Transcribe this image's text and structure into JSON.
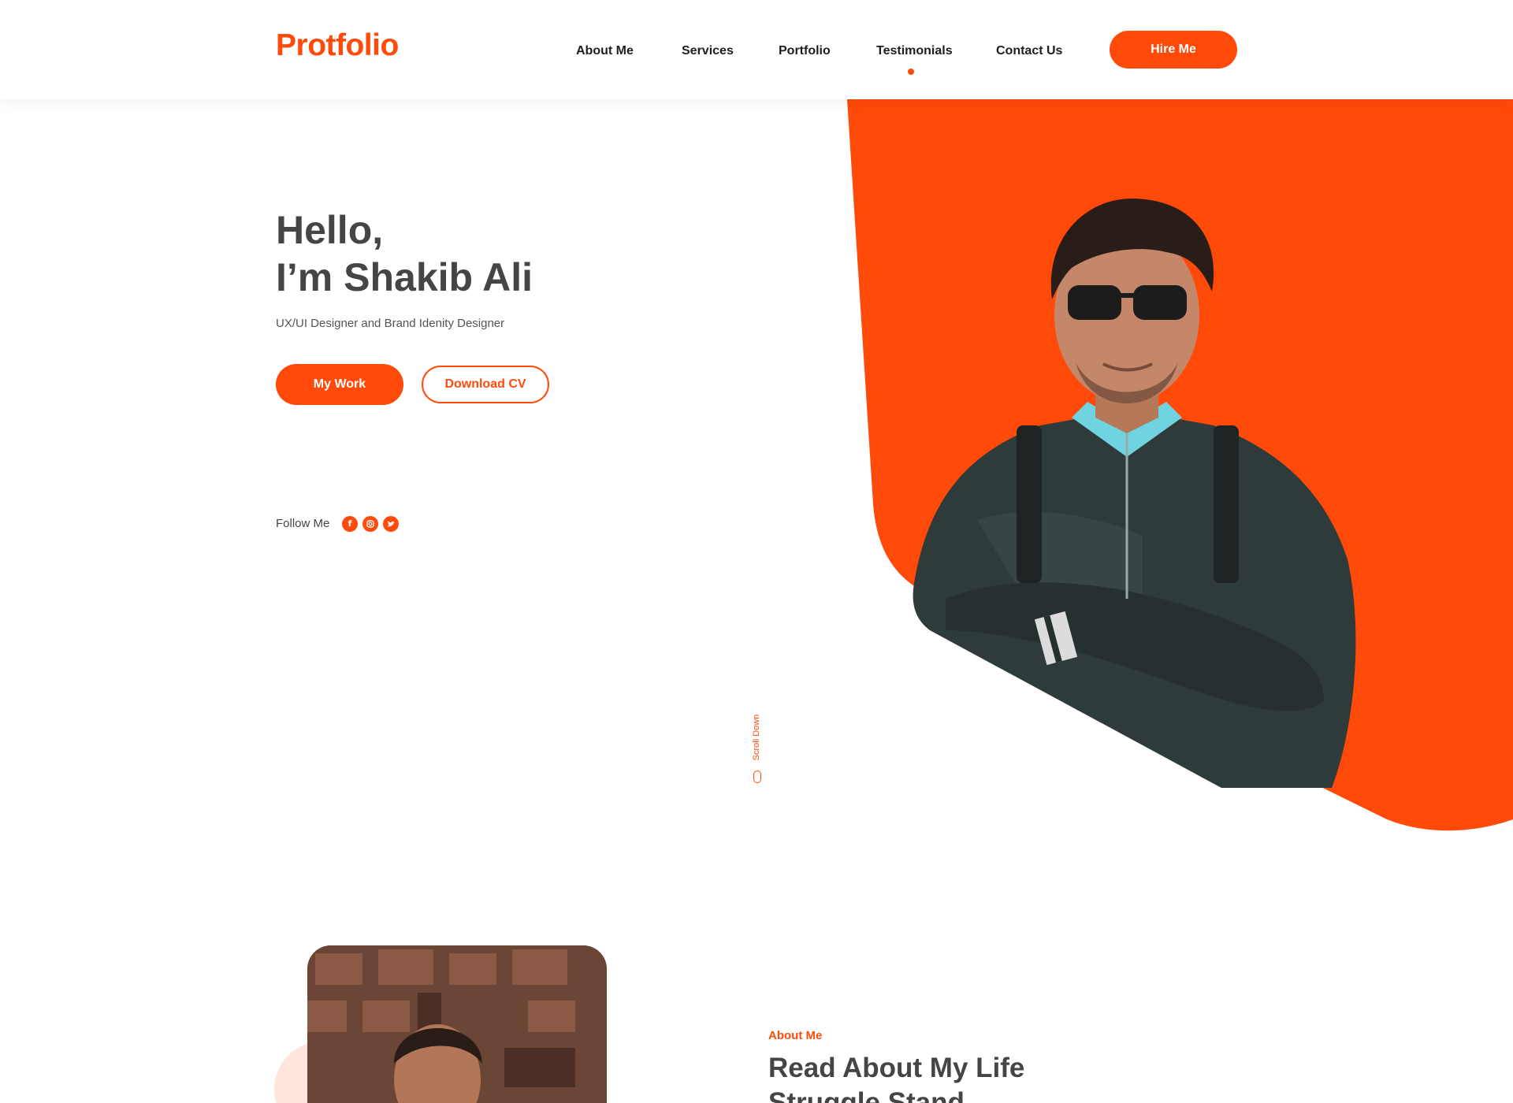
{
  "brand": {
    "logo_text": "Protfolio",
    "accent": "#ff4a0a"
  },
  "nav": {
    "items": [
      "About Me",
      "Services",
      "Portfolio",
      "Testimonials",
      "Contact Us"
    ],
    "active_item": "Testimonials",
    "hire_label": "Hire Me"
  },
  "hero": {
    "greeting": "Hello,",
    "name_line": "I’m Shakib Ali",
    "subtitle": "UX/UI Designer and Brand Idenity Designer",
    "primary_button": "My Work",
    "secondary_button": "Download CV",
    "follow_label": "Follow Me",
    "social_icons": [
      "facebook-icon",
      "instagram-icon",
      "twitter-icon"
    ],
    "scroll_label": "Scroll Down"
  },
  "about": {
    "label": "About Me",
    "title_line1": "Read About My Life",
    "title_line2": "Struggle Stand"
  }
}
